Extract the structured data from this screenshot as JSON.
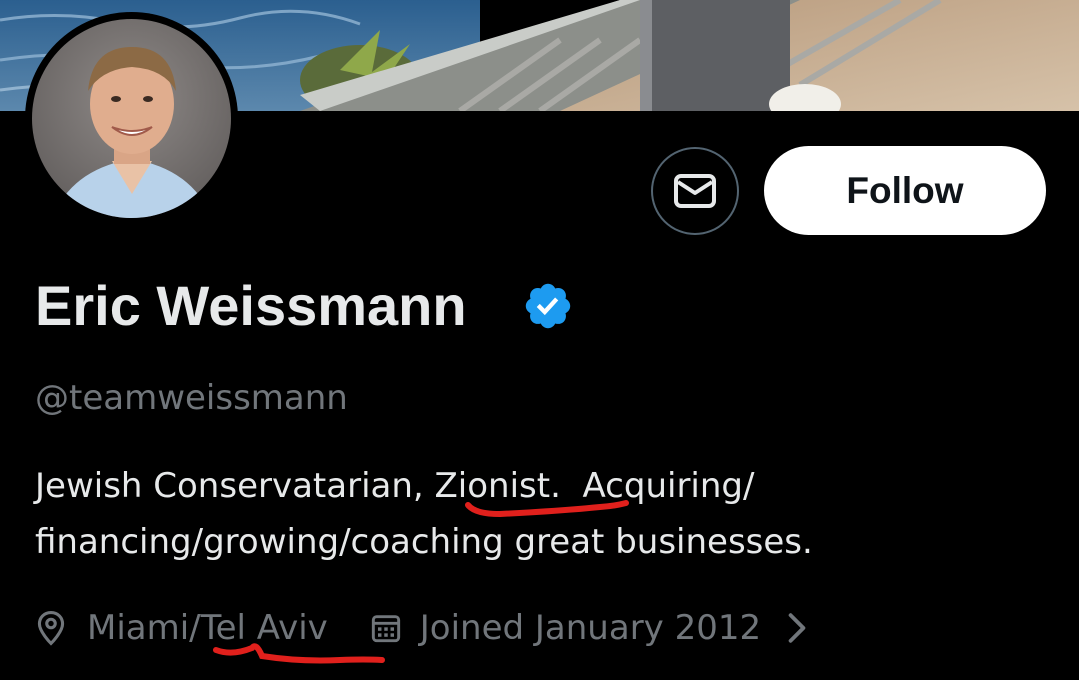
{
  "profile": {
    "display_name": "Eric Weissmann",
    "verified": true,
    "handle": "@teamweissmann",
    "bio_lines": [
      "Jewish Conservatarian, Zionist.  Acquiring/",
      "financing/growing/coaching great businesses."
    ],
    "location": "Miami/Tel Aviv",
    "joined": "Joined January 2012"
  },
  "actions": {
    "follow_label": "Follow",
    "message_icon": "envelope-icon"
  },
  "icons": {
    "verified": "verified-badge-icon",
    "location": "map-pin-icon",
    "joined": "calendar-icon",
    "more": "chevron-right-icon"
  },
  "colors": {
    "background": "#000000",
    "primary_text": "#e7e9ea",
    "secondary_text": "#71767b",
    "verified_blue": "#1d9bf0",
    "follow_button_bg": "#ffffff",
    "annotation_red": "#e0201c"
  }
}
